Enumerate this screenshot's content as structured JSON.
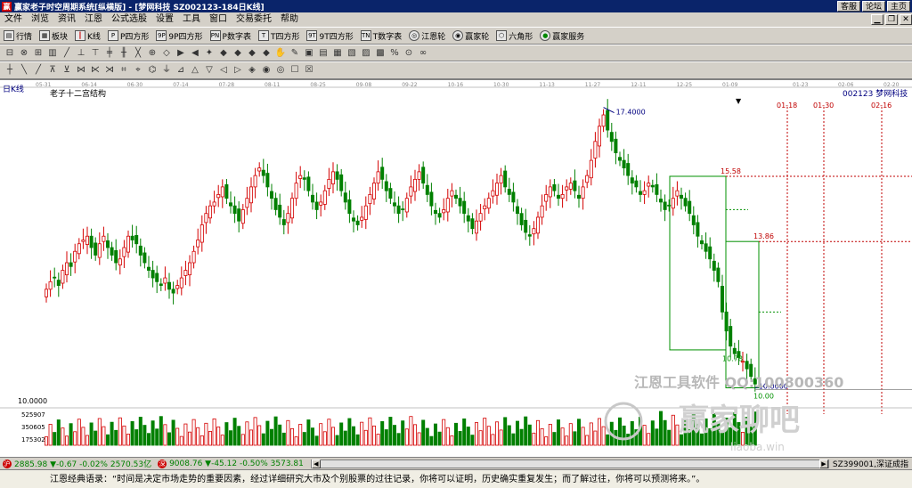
{
  "window": {
    "title": "赢家老子时空周期系统[纵横版] - [梦网科技   SZ002123-184日K线]",
    "links": [
      "客服",
      "论坛",
      "主页"
    ]
  },
  "menu": {
    "items": [
      "文件",
      "浏览",
      "资讯",
      "江恩",
      "公式选股",
      "设置",
      "工具",
      "窗口",
      "交易委托",
      "帮助"
    ]
  },
  "funcbar": {
    "items": [
      {
        "label": "行情",
        "icon": "market-icon"
      },
      {
        "label": "板块",
        "icon": "sector-icon"
      },
      {
        "label": "K线",
        "icon": "kline-icon"
      },
      {
        "label": "P四方形",
        "icon": "square-icon"
      },
      {
        "label": "9P四方形",
        "icon": "square9-icon"
      },
      {
        "label": "P数字表",
        "icon": "number-table-icon"
      },
      {
        "label": "T四方形",
        "icon": "t-square-icon"
      },
      {
        "label": "9T四方形",
        "icon": "t-square9-icon"
      },
      {
        "label": "T数字表",
        "icon": "t-number-table-icon"
      },
      {
        "label": "江恩轮",
        "icon": "gann-wheel-icon"
      },
      {
        "label": "赢家轮",
        "icon": "winner-wheel-icon"
      },
      {
        "label": "六角形",
        "icon": "hexagon-icon"
      },
      {
        "label": "赢家服务",
        "icon": "service-icon"
      }
    ]
  },
  "chart": {
    "period_label": "日K线",
    "indicator_label": "老子十二宫结构",
    "stock_label": "002123  梦网科技",
    "watermark_main": "江恩工具软件 QQ:100800360",
    "watermark_logo": "赢家聊吧",
    "watermark_url": "liaoba.win"
  },
  "chart_data": {
    "type": "candlestick",
    "x_dates": [
      "05-31",
      "06-14",
      "06-30",
      "07-14",
      "07-28",
      "08-11",
      "08-25",
      "09-08",
      "09-22",
      "10-16",
      "10-30",
      "11-13",
      "11-27",
      "12-11",
      "12-25",
      "01-09"
    ],
    "future_dates_axis": [
      "01-23",
      "02-06",
      "02-20"
    ],
    "future_markers": [
      "01-18",
      "01-30",
      "02-16"
    ],
    "price_levels": [
      {
        "label": "17.4000",
        "kind": "high"
      },
      {
        "label": "15.58",
        "kind": "level"
      },
      {
        "label": "13.86",
        "kind": "level"
      },
      {
        "label": "10.78",
        "kind": "level"
      },
      {
        "label": "10.00",
        "kind": "level"
      },
      {
        "label": "10.0000",
        "kind": "low"
      }
    ],
    "y_axis_label": "10.0000",
    "volume_ticks": [
      "525907",
      "350605",
      "175302"
    ],
    "closes": [
      12.6,
      12.8,
      12.9,
      12.7,
      13.1,
      13.3,
      13.2,
      13.6,
      13.8,
      13.9,
      14.0,
      13.7,
      13.5,
      13.8,
      14.0,
      13.7,
      13.5,
      13.3,
      13.4,
      13.7,
      14.0,
      13.9,
      13.8,
      13.5,
      13.3,
      13.1,
      12.9,
      12.8,
      12.7,
      12.9,
      12.6,
      12.5,
      12.7,
      12.9,
      13.1,
      13.3,
      13.6,
      13.9,
      14.3,
      14.6,
      14.8,
      14.9,
      15.1,
      15.3,
      15.0,
      14.8,
      14.6,
      14.4,
      14.7,
      15.0,
      15.3,
      15.6,
      15.8,
      15.6,
      15.3,
      15.0,
      14.7,
      14.5,
      14.3,
      14.6,
      15.0,
      15.4,
      15.6,
      15.5,
      15.2,
      14.9,
      14.7,
      14.9,
      15.2,
      15.5,
      15.7,
      15.5,
      15.2,
      14.9,
      14.6,
      14.4,
      14.3,
      14.5,
      14.8,
      15.1,
      15.4,
      15.7,
      15.5,
      15.2,
      15.0,
      14.8,
      14.6,
      14.7,
      15.0,
      15.3,
      15.5,
      15.7,
      15.4,
      15.1,
      14.8,
      14.6,
      14.5,
      14.7,
      15.0,
      15.2,
      15.0,
      14.8,
      14.6,
      14.4,
      14.2,
      14.4,
      14.6,
      14.8,
      15.0,
      15.2,
      15.4,
      15.6,
      15.3,
      15.1,
      14.9,
      14.6,
      14.3,
      14.1,
      14.0,
      14.2,
      14.5,
      14.8,
      15.1,
      15.3,
      15.2,
      15.0,
      15.1,
      15.3,
      15.4,
      15.2,
      15.0,
      15.3,
      15.6,
      16.0,
      16.5,
      16.9,
      17.2,
      16.8,
      16.5,
      16.2,
      16.0,
      15.8,
      15.6,
      15.4,
      15.3,
      15.1,
      15.2,
      15.4,
      15.3,
      15.1,
      14.9,
      14.7,
      14.8,
      15.0,
      15.2,
      15.0,
      14.8,
      14.6,
      14.3,
      14.0,
      13.8,
      13.6,
      13.4,
      13.1,
      12.8,
      12.0,
      11.5,
      11.1,
      10.9,
      10.8,
      10.7,
      10.5,
      10.3,
      10.1
    ],
    "volume_scale_max": 700000
  },
  "status": {
    "sh_icon": "沪",
    "sh_text": "2885.98 ▼-0.67 -0.02% 2570.53亿",
    "sz_icon": "深",
    "sz_text": "9008.76 ▼-45.12 -0.50% 3573.81",
    "right_text": "SZ399001,深证成指"
  },
  "quote": {
    "text": "江恩经典语录：“时间是决定市场走势的重要因素，经过详细研究大市及个别股票的过往记录，你将可以证明，历史确实重复发生；而了解过往，你将可以预测将来。”。"
  },
  "colors": {
    "up": "#d40000",
    "down": "#008000",
    "title_bg": "#0a246a",
    "box": "#009000",
    "level": "#c00000"
  }
}
